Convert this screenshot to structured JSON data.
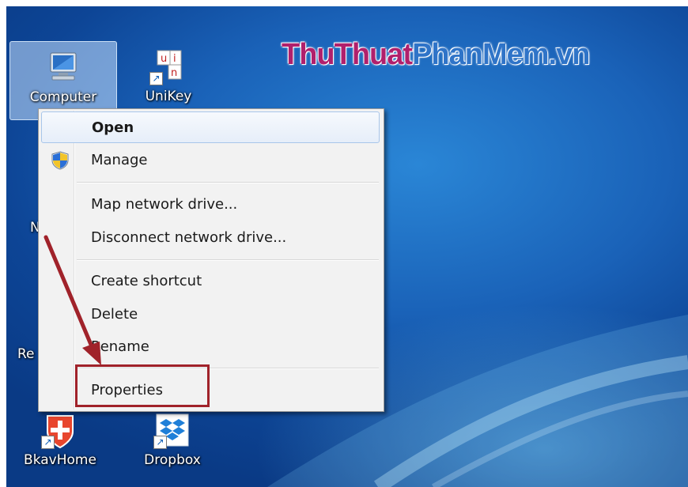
{
  "watermark": {
    "part_a": "ThuThuat",
    "part_b": "PhanMem.vn"
  },
  "desktop_icons": {
    "computer": "Computer",
    "unikey": "UniKey",
    "bkavhome": "BkavHome",
    "dropbox": "Dropbox",
    "partial_n": "N",
    "partial_re": "Re"
  },
  "context_menu": {
    "items": [
      {
        "label": "Open",
        "default": true,
        "hover": true
      },
      {
        "label": "Manage",
        "icon": "uac-shield-icon"
      },
      {
        "label": "Map network drive..."
      },
      {
        "label": "Disconnect network drive..."
      },
      {
        "label": "Create shortcut"
      },
      {
        "label": "Delete"
      },
      {
        "label": "Rename"
      },
      {
        "label": "Properties",
        "highlighted": true
      }
    ]
  },
  "colors": {
    "accent_red": "#a0222a",
    "desktop_blue": "#1a62b8",
    "watermark_pink": "#b0206c",
    "watermark_blue": "#2f74c8"
  }
}
